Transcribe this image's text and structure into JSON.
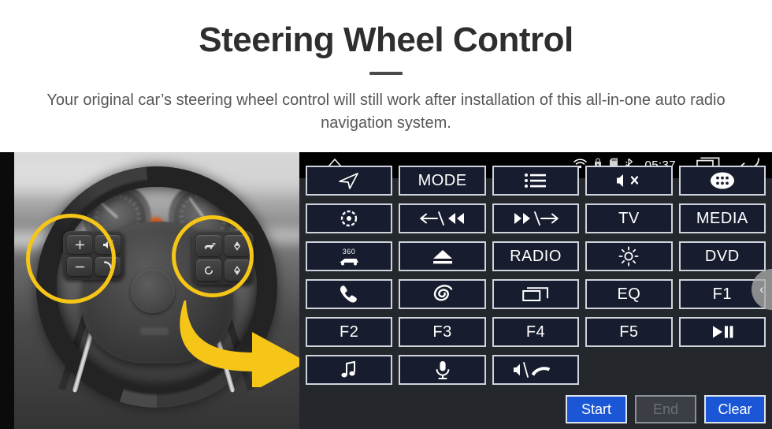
{
  "header": {
    "title": "Steering Wheel Control",
    "subtitle": "Your original car’s steering wheel control will still work after installation of this all-in-one auto radio navigation system."
  },
  "colors": {
    "accent_yellow": "#f5c518",
    "button_blue": "#1a56d6",
    "panel_bg": "#24272c",
    "key_fill": "#171d2e",
    "key_border": "#cfd3dd",
    "statusbar_bg": "#000000"
  },
  "photo": {
    "alt": "car steering wheel with control buttons highlighted",
    "left_cluster": [
      {
        "name": "volume-up-key",
        "glyph": "+"
      },
      {
        "name": "mute-key",
        "glyph": "mute-icon"
      },
      {
        "name": "volume-down-key",
        "glyph": "−"
      },
      {
        "name": "phone-key",
        "glyph": "phone-icon"
      }
    ],
    "right_cluster": [
      {
        "name": "cruise-key",
        "glyph": "cruise-icon"
      },
      {
        "name": "up-key",
        "glyph": "up-icon"
      },
      {
        "name": "circle-key",
        "glyph": "circle-icon"
      },
      {
        "name": "down-key",
        "glyph": "down-icon"
      }
    ]
  },
  "unit": {
    "statusbar": {
      "home_icon": "home-icon",
      "wifi_icon": "wifi-icon",
      "lock_icon": "lock-icon",
      "sdcard_icon": "sdcard-icon",
      "bluetooth_icon": "bluetooth-icon",
      "time": "05:37",
      "recents_icon": "recents-icon",
      "back_icon": "back-icon"
    },
    "keys": [
      {
        "name": "navigation-key",
        "type": "icon",
        "icon": "navigation-arrow-icon",
        "label": ""
      },
      {
        "name": "mode-key",
        "type": "text",
        "icon": "",
        "label": "MODE"
      },
      {
        "name": "list-key",
        "type": "icon",
        "icon": "list-icon",
        "label": ""
      },
      {
        "name": "mute-key",
        "type": "icon",
        "icon": "mute-icon",
        "label": ""
      },
      {
        "name": "apps-key",
        "type": "icon",
        "icon": "apps-grid-icon",
        "label": ""
      },
      {
        "name": "setting-key",
        "type": "icon",
        "icon": "target-gear-icon",
        "label": ""
      },
      {
        "name": "prev-key",
        "type": "icon",
        "icon": "prev-track-icon",
        "label": ""
      },
      {
        "name": "next-key",
        "type": "icon",
        "icon": "next-track-icon",
        "label": ""
      },
      {
        "name": "tv-key",
        "type": "text",
        "icon": "",
        "label": "TV"
      },
      {
        "name": "media-key",
        "type": "text",
        "icon": "",
        "label": "MEDIA"
      },
      {
        "name": "camera360-key",
        "type": "icon",
        "icon": "car-360-icon",
        "label": "360"
      },
      {
        "name": "eject-key",
        "type": "icon",
        "icon": "eject-icon",
        "label": ""
      },
      {
        "name": "radio-key",
        "type": "text",
        "icon": "",
        "label": "RADIO"
      },
      {
        "name": "brightness-key",
        "type": "icon",
        "icon": "brightness-icon",
        "label": ""
      },
      {
        "name": "dvd-key",
        "type": "text",
        "icon": "",
        "label": "DVD"
      },
      {
        "name": "phone-key",
        "type": "icon",
        "icon": "phone-icon",
        "label": ""
      },
      {
        "name": "swirl-key",
        "type": "icon",
        "icon": "swirl-icon",
        "label": ""
      },
      {
        "name": "window-key",
        "type": "icon",
        "icon": "window-icon",
        "label": ""
      },
      {
        "name": "eq-key",
        "type": "text",
        "icon": "",
        "label": "EQ"
      },
      {
        "name": "f1-key",
        "type": "text",
        "icon": "",
        "label": "F1"
      },
      {
        "name": "f2-key",
        "type": "text",
        "icon": "",
        "label": "F2"
      },
      {
        "name": "f3-key",
        "type": "text",
        "icon": "",
        "label": "F3"
      },
      {
        "name": "f4-key",
        "type": "text",
        "icon": "",
        "label": "F4"
      },
      {
        "name": "f5-key",
        "type": "text",
        "icon": "",
        "label": "F5"
      },
      {
        "name": "play-pause-key",
        "type": "icon",
        "icon": "play-pause-icon",
        "label": ""
      },
      {
        "name": "music-key",
        "type": "icon",
        "icon": "music-note-icon",
        "label": ""
      },
      {
        "name": "mic-key",
        "type": "icon",
        "icon": "microphone-icon",
        "label": ""
      },
      {
        "name": "speaker-hangup-key",
        "type": "icon",
        "icon": "speaker-hangup-icon",
        "label": ""
      },
      {
        "name": "empty-key-1",
        "type": "empty",
        "icon": "",
        "label": ""
      },
      {
        "name": "empty-key-2",
        "type": "empty",
        "icon": "",
        "label": ""
      }
    ],
    "actions": [
      {
        "name": "start-button",
        "label": "Start",
        "state": "enabled"
      },
      {
        "name": "end-button",
        "label": "End",
        "state": "disabled"
      },
      {
        "name": "clear-button",
        "label": "Clear",
        "state": "enabled"
      }
    ],
    "edge_handle": {
      "name": "edge-panel-handle",
      "glyph": "‹"
    }
  }
}
